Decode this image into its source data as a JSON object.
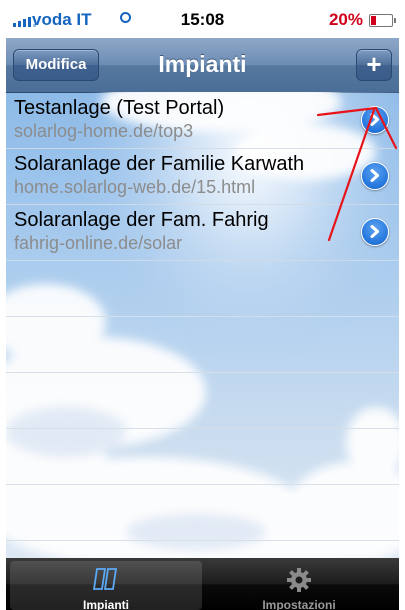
{
  "status_bar": {
    "carrier": "voda IT",
    "time": "15:08",
    "battery_percent": "20%"
  },
  "nav_bar": {
    "title": "Impianti",
    "edit_button": "Modifica",
    "add_button": "+"
  },
  "list": {
    "items": [
      {
        "title": "Testanlage (Test Portal)",
        "subtitle": "solarlog-home.de/top3"
      },
      {
        "title": "Solaranlage der Familie Karwath",
        "subtitle": "home.solarlog-web.de/15.html"
      },
      {
        "title": "Solaranlage der Fam. Fahrig",
        "subtitle": "fahrig-online.de/solar"
      }
    ]
  },
  "tab_bar": {
    "tabs": [
      {
        "label": "Impianti",
        "icon": "panels-icon",
        "active": true
      },
      {
        "label": "Impostazioni",
        "icon": "gear-icon",
        "active": false
      }
    ]
  },
  "colors": {
    "accent": "#2a7be0",
    "nav_bar": "#6d8db4",
    "annotation": "#e8141c",
    "battery_low": "#d0011b"
  }
}
